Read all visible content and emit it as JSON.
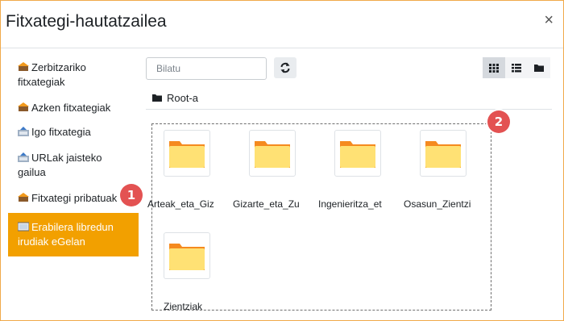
{
  "dialog": {
    "title": "Fitxategi-hautatzailea",
    "close_symbol": "×"
  },
  "sidebar": {
    "items": [
      {
        "label": "Zerbitzariko fitxategiak",
        "icon": "server-icon"
      },
      {
        "label": "Azken fitxategiak",
        "icon": "recent-files-icon"
      },
      {
        "label": "Igo fitxategia",
        "icon": "upload-icon"
      },
      {
        "label": "URLak jaisteko gailua",
        "icon": "url-download-icon"
      },
      {
        "label": "Fitxategi pribatuak",
        "icon": "private-files-icon"
      },
      {
        "label": "Erabilera libredun irudiak eGelan",
        "icon": "image-icon",
        "active": true
      }
    ]
  },
  "toolbar": {
    "search_placeholder": "Bilatu"
  },
  "breadcrumb": {
    "root_label": "Root-a"
  },
  "files": [
    {
      "name": "Arteak_eta_Giz"
    },
    {
      "name": "Gizarte_eta_Zu"
    },
    {
      "name": "Ingenieritza_et"
    },
    {
      "name": "Osasun_Zientzi"
    },
    {
      "name": "Zientziak"
    }
  ],
  "annotations": {
    "badge1": "1",
    "badge2": "2"
  },
  "colors": {
    "accent": "#f2a000",
    "badge": "#e35252",
    "folder_body": "#ffe174",
    "folder_tab": "#f58a1f"
  }
}
